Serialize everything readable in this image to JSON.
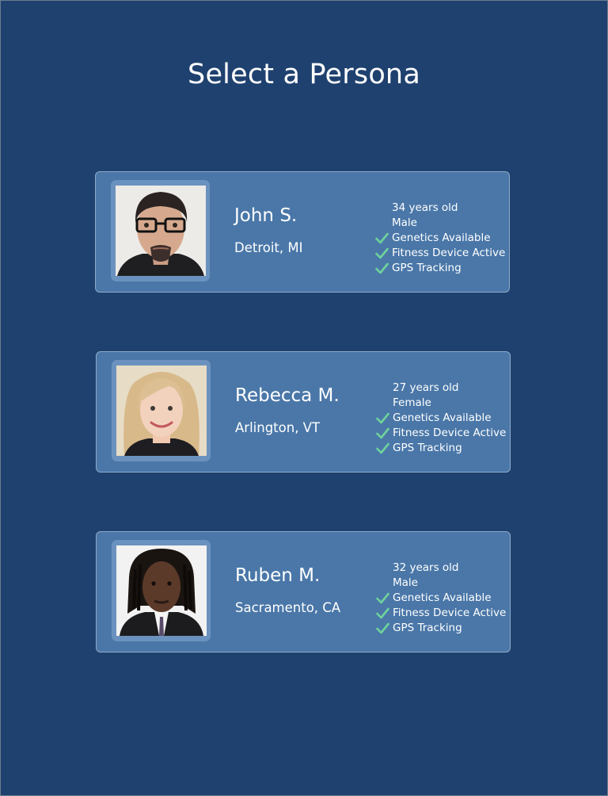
{
  "page": {
    "title": "Select a Persona"
  },
  "colors": {
    "background": "#1f416f",
    "card": "#4a77a8",
    "check": "#6fd39c"
  },
  "personas": [
    {
      "name": "John S.",
      "location": "Detroit, MI",
      "age": "34 years old",
      "gender": "Male",
      "features": [
        "Genetics Available",
        "Fitness Device Active",
        "GPS Tracking"
      ]
    },
    {
      "name": "Rebecca M.",
      "location": "Arlington, VT",
      "age": "27 years old",
      "gender": "Female",
      "features": [
        "Genetics Available",
        "Fitness Device Active",
        "GPS Tracking"
      ]
    },
    {
      "name": "Ruben M.",
      "location": "Sacramento, CA",
      "age": "32 years old",
      "gender": "Male",
      "features": [
        "Genetics Available",
        "Fitness Device Active",
        "GPS Tracking"
      ]
    }
  ]
}
